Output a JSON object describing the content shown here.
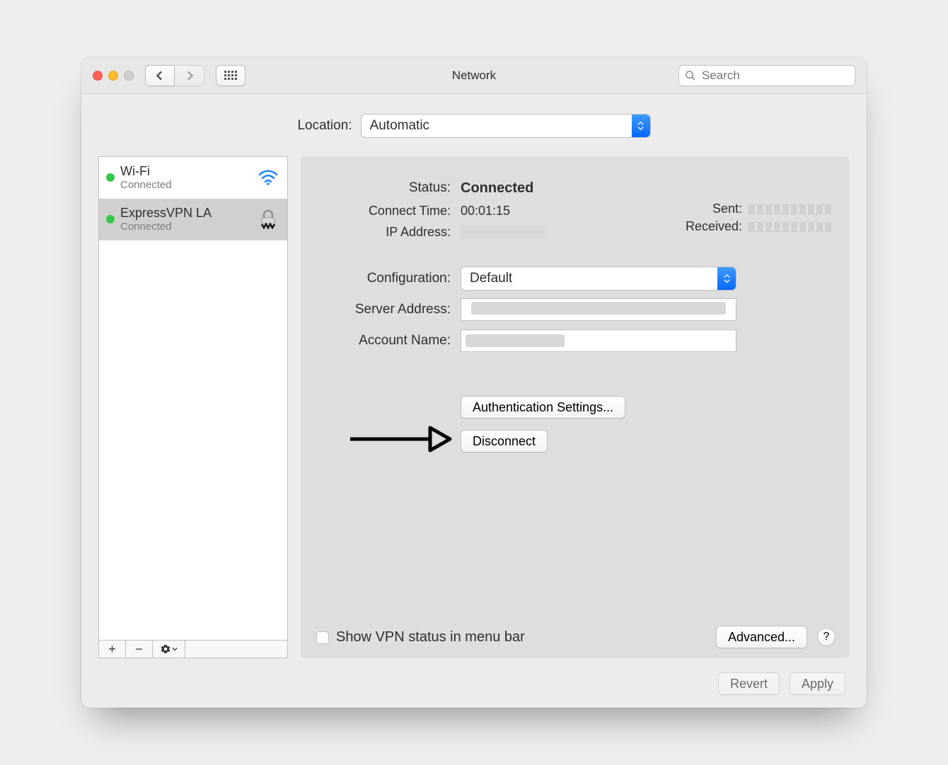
{
  "titlebar": {
    "title": "Network",
    "search_placeholder": "Search"
  },
  "location": {
    "label": "Location:",
    "value": "Automatic"
  },
  "sidebar": {
    "items": [
      {
        "name": "Wi-Fi",
        "state": "Connected",
        "icon": "wifi",
        "status": "green",
        "selected": false
      },
      {
        "name": "ExpressVPN LA",
        "state": "Connected",
        "icon": "vpn",
        "status": "green",
        "selected": true
      }
    ]
  },
  "detail": {
    "status_label": "Status:",
    "status_value": "Connected",
    "connect_time_label": "Connect Time:",
    "connect_time_value": "00:01:15",
    "ip_label": "IP Address:",
    "sent_label": "Sent:",
    "received_label": "Received:",
    "config_label": "Configuration:",
    "config_value": "Default",
    "server_label": "Server Address:",
    "account_label": "Account Name:",
    "auth_button": "Authentication Settings...",
    "disconnect_button": "Disconnect",
    "show_menu_bar_label": "Show VPN status in menu bar",
    "advanced_button": "Advanced...",
    "help_button": "?"
  },
  "footer": {
    "revert": "Revert",
    "apply": "Apply"
  }
}
